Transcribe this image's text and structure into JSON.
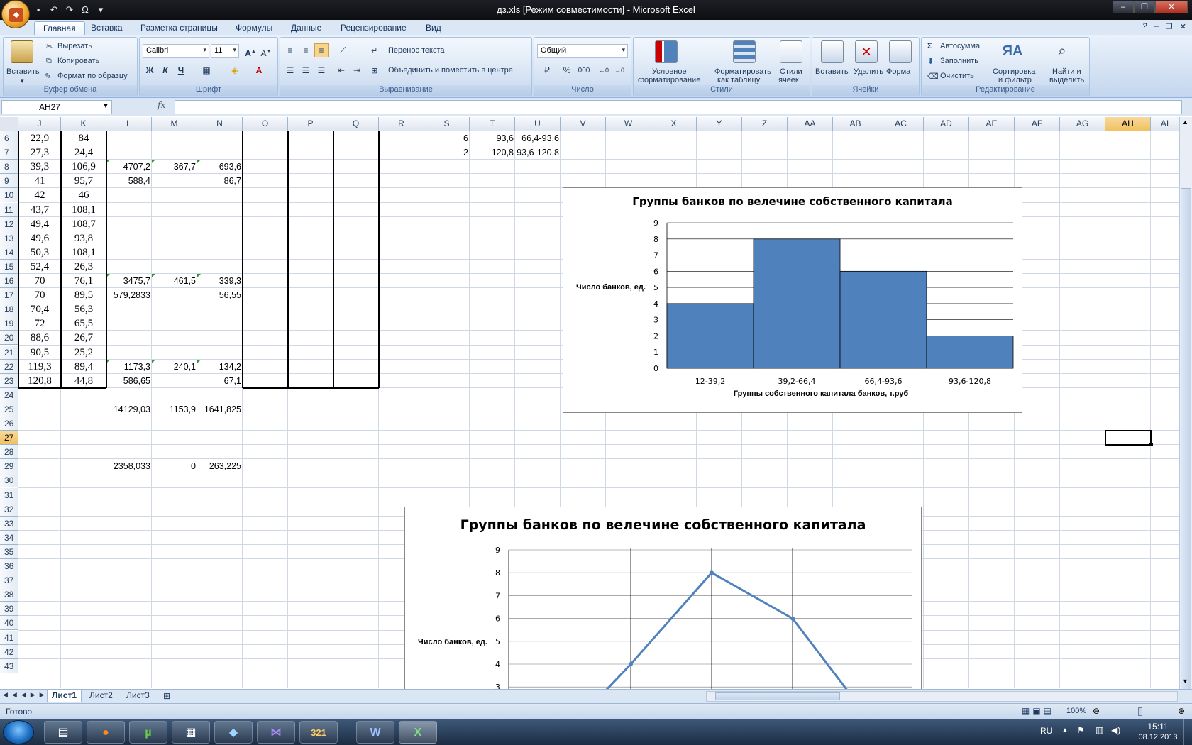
{
  "window": {
    "title": "дз.xls  [Режим совместимости] - Microsoft Excel",
    "office_button": "Office"
  },
  "ribbon_tabs": [
    "Главная",
    "Вставка",
    "Разметка страницы",
    "Формулы",
    "Данные",
    "Рецензирование",
    "Вид"
  ],
  "ribbon": {
    "clipboard": {
      "paste": "Вставить",
      "cut": "Вырезать",
      "copy": "Копировать",
      "format_painter": "Формат по образцу",
      "label": "Буфер обмена"
    },
    "font": {
      "name": "Calibri",
      "size": "11",
      "label": "Шрифт",
      "bold": "Ж",
      "italic": "К",
      "underline": "Ч"
    },
    "alignment": {
      "wrap": "Перенос текста",
      "merge": "Объединить и поместить в центре",
      "label": "Выравнивание"
    },
    "number": {
      "format": "Общий",
      "label": "Число",
      "percent": "%",
      "thousands": "000"
    },
    "styles": {
      "conditional_1": "Условное",
      "conditional_2": "форматирование",
      "table_1": "Форматировать",
      "table_2": "как таблицу",
      "cell_1": "Стили",
      "cell_2": "ячеек",
      "label": "Стили"
    },
    "cells": {
      "insert": "Вставить",
      "delete": "Удалить",
      "format": "Формат",
      "label": "Ячейки"
    },
    "editing": {
      "autosum": "Автосумма",
      "fill": "Заполнить",
      "clear": "Очистить",
      "sort_1": "Сортировка",
      "sort_2": "и фильтр",
      "find_1": "Найти и",
      "find_2": "выделить",
      "label": "Редактирование"
    }
  },
  "formula_bar": {
    "name_box": "AH27",
    "fx": "fx",
    "value": ""
  },
  "columns": [
    "J",
    "K",
    "L",
    "M",
    "N",
    "O",
    "P",
    "Q",
    "R",
    "S",
    "T",
    "U",
    "V",
    "W",
    "X",
    "Y",
    "Z",
    "AA",
    "AB",
    "AC",
    "AD",
    "AE",
    "AF",
    "AG",
    "AH",
    "AI"
  ],
  "rows": [
    "6",
    "7",
    "8",
    "9",
    "10",
    "11",
    "12",
    "13",
    "14",
    "15",
    "16",
    "17",
    "18",
    "19",
    "20",
    "21",
    "22",
    "23",
    "24",
    "25",
    "26",
    "27",
    "28",
    "29",
    "30",
    "31",
    "32",
    "33",
    "34",
    "35",
    "36",
    "37",
    "38",
    "39",
    "40",
    "41",
    "42",
    "43"
  ],
  "cells": {
    "J": [
      "22,9",
      "27,3",
      "39,3",
      "41",
      "42",
      "43,7",
      "49,4",
      "49,6",
      "50,3",
      "52,4",
      "70",
      "70",
      "70,4",
      "72",
      "88,6",
      "90,5",
      "119,3",
      "120,8"
    ],
    "K": [
      "84",
      "24,4",
      "106,9",
      "95,7",
      "46",
      "108,1",
      "108,7",
      "93,8",
      "108,1",
      "26,3",
      "76,1",
      "89,5",
      "56,3",
      "65,5",
      "26,7",
      "25,2",
      "89,4",
      "44,8"
    ],
    "L8": "4707,2",
    "M8": "367,7",
    "N8": "693,6",
    "L9": "588,4",
    "N9": "86,7",
    "L16": "3475,7",
    "M16": "461,5",
    "N16": "339,3",
    "L17": "579,2833",
    "N17": "56,55",
    "L22": "1173,3",
    "M22": "240,1",
    "N22": "134,2",
    "L23": "586,65",
    "N23": "67,1",
    "L25": "14129,03",
    "M25": "1153,9",
    "N25": "1641,825",
    "L29": "2358,033",
    "M29": "0",
    "N29": "263,225",
    "S6": "6",
    "T6": "93,6",
    "U6": "66,4-93,6",
    "S7": "2",
    "T7": "120,8",
    "U7": "93,6-120,8"
  },
  "chart_data": [
    {
      "type": "bar",
      "title": "Группы банков по велечине собственного капитала",
      "xlabel": "Группы собственного  капитала  банков, т.руб",
      "ylabel": "Число банков,  ед.",
      "categories": [
        "12-39,2",
        "39,2-66,4",
        "66,4-93,6",
        "93,6-120,8"
      ],
      "values": [
        4,
        8,
        6,
        2
      ],
      "ylim": [
        0,
        9
      ],
      "yticks": [
        "0",
        "1",
        "2",
        "3",
        "4",
        "5",
        "6",
        "7",
        "8",
        "9"
      ],
      "color": "#4f81bd",
      "grid": true
    },
    {
      "type": "line",
      "title": "Группы банков по велечине собственного капитала",
      "ylabel": "Число банков,  ед.",
      "yticks_visible": [
        "3",
        "4",
        "5",
        "6",
        "7",
        "8",
        "9"
      ],
      "ylim": [
        0,
        9
      ],
      "points_visible": [
        4,
        8,
        6
      ],
      "color": "#4f81bd",
      "grid": true
    }
  ],
  "sheet_tabs": [
    "Лист1",
    "Лист2",
    "Лист3"
  ],
  "status": {
    "ready": "Готово",
    "zoom": "100%"
  },
  "taskbar": {
    "lang": "RU",
    "time": "15:11",
    "date": "08.12.2013"
  }
}
